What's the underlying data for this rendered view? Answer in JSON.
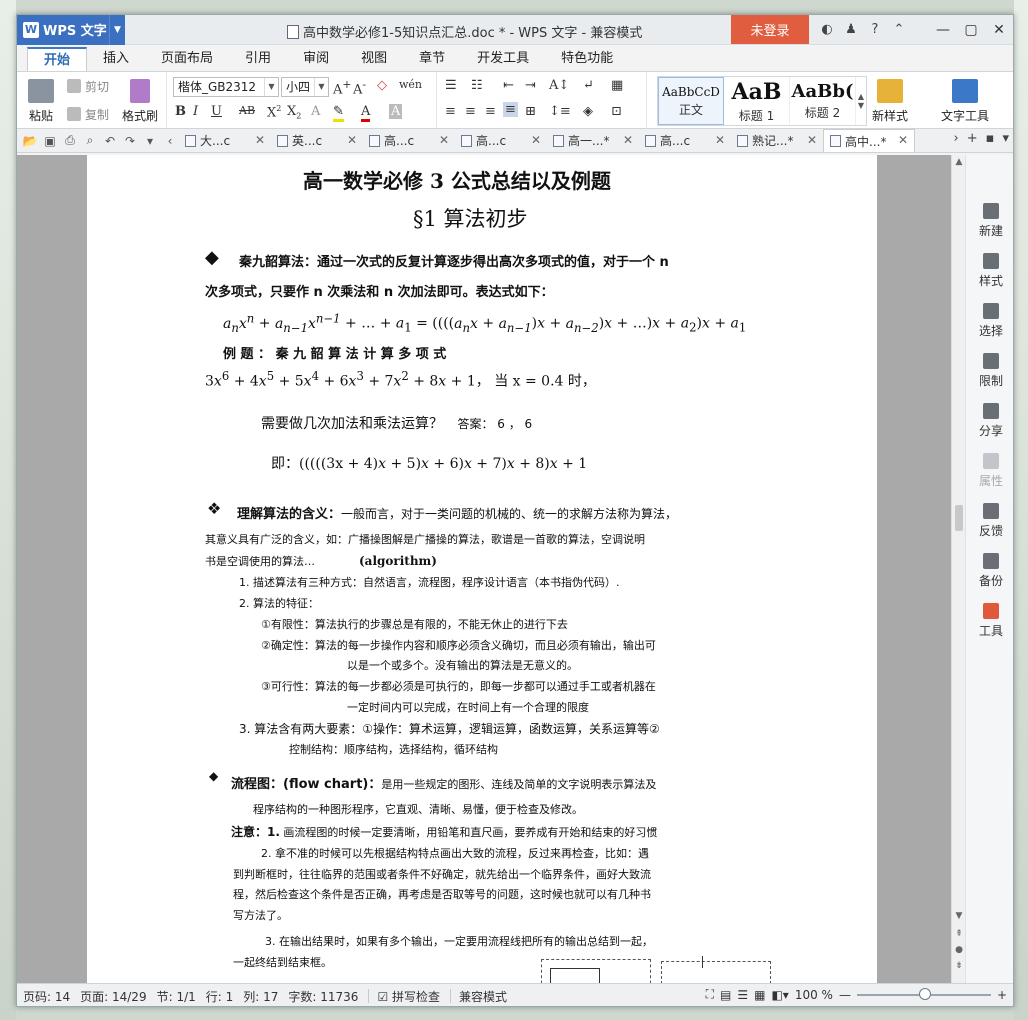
{
  "titlebar": {
    "app_name": "WPS 文字",
    "doc_title": "高中数学必修1-5知识点汇总.doc * - WPS 文字 - 兼容模式",
    "login": "未登录"
  },
  "menu": [
    "开始",
    "插入",
    "页面布局",
    "引用",
    "审阅",
    "视图",
    "章节",
    "开发工具",
    "特色功能"
  ],
  "ribbon": {
    "paste": "粘贴",
    "cut": "剪切",
    "copy": "复制",
    "format_painter": "格式刷",
    "font_name": "楷体_GB2312",
    "font_size": "小四",
    "styles": [
      {
        "sample": "AaBbCcD",
        "name": "正文"
      },
      {
        "sample": "AaB",
        "name": "标题 1"
      },
      {
        "sample": "AaBb(",
        "name": "标题 2"
      }
    ],
    "new_style": "新样式",
    "text_tools": "文字工具"
  },
  "doc_tabs": [
    {
      "label": "大...c"
    },
    {
      "label": "英...c"
    },
    {
      "label": "高...c"
    },
    {
      "label": "高...c"
    },
    {
      "label": "高一...*"
    },
    {
      "label": "高...c"
    },
    {
      "label": "熟记...*"
    },
    {
      "label": "高中...*"
    }
  ],
  "side_panel": [
    "新建",
    "样式",
    "选择",
    "限制",
    "分享",
    "属性",
    "反馈",
    "备份",
    "工具"
  ],
  "document": {
    "title": "高一数学必修 3 公式总结以及例题",
    "section": "§1  算法初步",
    "qin_head": "秦九韶算法：通过一次式的反复计算逐步得出高次多项式的值，对于一个 n",
    "qin_line2": "次多项式，只要作 n 次乘法和 n 次加法即可。表达式如下：",
    "example_label": "例      题      ：      秦      九      韶      算      法      计      算      多      项      式",
    "example_when": "，  当 x = 0.4 时，",
    "question": "需要做几次加法和乘法运算？",
    "answer": "答案：   6  ，  6",
    "ji": "即：",
    "understand_head": "理解算法的含义：",
    "understand_l1": "一般而言，对于一类问题的机械的、统一的求解方法称为算法，",
    "understand_l2": "其意义具有广泛的含义，如：广播操图解是广播操的算法，歌谱是一首歌的算法，空调说明",
    "understand_l3": "书是空调使用的算法…",
    "algorithm_en": "(algorithm)",
    "item1": "1. 描述算法有三种方式：自然语言，流程图，程序设计语言（本书指伪代码）.",
    "item2": "2. 算法的特征：",
    "f1": "①有限性：算法执行的步骤总是有限的，不能无休止的进行下去",
    "f2": "②确定性：算法的每一步操作内容和顺序必须含义确切，而且必须有输出，输出可",
    "f2b": "以是一个或多个。没有输出的算法是无意义的。",
    "f3": "③可行性：算法的每一步都必须是可执行的，即每一步都可以通过手工或者机器在",
    "f3b": "一定时间内可以完成，在时间上有一个合理的限度",
    "item3": "3.  算法含有两大要素：①操作：算术运算，逻辑运算，函数运算，关系运算等②",
    "item3b": "控制结构：顺序结构，选择结构，循环结构",
    "flow_head": "流程图：(flow chart)：",
    "flow_l1": "是用一些规定的图形、连线及简单的文字说明表示算法及",
    "flow_l2": "程序结构的一种图形程序，它直观、清晰、易懂，便于检查及修改。",
    "note_head": "注意：1.",
    "note1": "画流程图的时候一定要清晰，用铅笔和直尺画，要养成有开始和结束的好习惯",
    "note2a": "2. 拿不准的时候可以先根据结构特点画出大致的流程，反过来再检查，比如：遇",
    "note2b": "到判断框时，往往临界的范围或者条件不好确定，就先给出一个临界条件，画好大致流",
    "note2c": "程，然后检查这个条件是否正确，再考虑是否取等号的问题，这时候也就可以有几种书",
    "note2d": "写方法了。",
    "note3a": "3. 在输出结果时，如果有多个输出，一定要用流程线把所有的输出总结到一起，",
    "note3b": "一起终结到结束框。"
  },
  "statusbar": {
    "page_no": "页码: 14",
    "page": "页面: 14/29",
    "section": "节: 1/1",
    "row": "行: 1",
    "col": "列: 17",
    "words": "字数: 11736",
    "spell": "拼写检查",
    "compat": "兼容模式",
    "zoom": "100 %"
  }
}
